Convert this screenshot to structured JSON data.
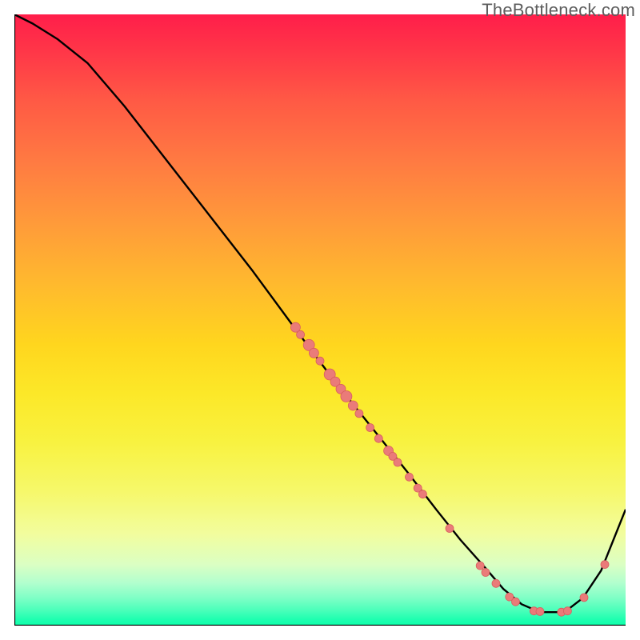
{
  "watermark": "TheBottleneck.com",
  "chart_data": {
    "type": "line",
    "title": "",
    "xlabel": "",
    "ylabel": "",
    "xlim": [
      0,
      100
    ],
    "ylim": [
      0,
      100
    ],
    "grid": false,
    "legend": false,
    "background_gradient": {
      "top": "#ff1e4a",
      "bottom": "#0fffaa"
    },
    "series": [
      {
        "name": "curve",
        "color": "#000000",
        "x": [
          0,
          3,
          7,
          12,
          18,
          25,
          32,
          39,
          46,
          52,
          58,
          64,
          69,
          73,
          77,
          80,
          83,
          86,
          90,
          93,
          96,
          98,
          100
        ],
        "y": [
          100,
          98.5,
          96,
          92,
          85,
          76,
          67,
          58,
          48.5,
          40.5,
          33,
          25.5,
          19,
          14,
          9.5,
          6,
          3.5,
          2.2,
          2.2,
          4.5,
          9,
          14,
          19
        ]
      }
    ],
    "scatter": [
      {
        "name": "red-points",
        "color": "#ea7b79",
        "points": [
          {
            "x": 46.0,
            "y": 48.8,
            "r": 6
          },
          {
            "x": 46.8,
            "y": 47.6,
            "r": 5
          },
          {
            "x": 48.2,
            "y": 45.9,
            "r": 7
          },
          {
            "x": 49.0,
            "y": 44.6,
            "r": 6
          },
          {
            "x": 50.0,
            "y": 43.3,
            "r": 5
          },
          {
            "x": 51.6,
            "y": 41.1,
            "r": 7
          },
          {
            "x": 52.5,
            "y": 39.9,
            "r": 6
          },
          {
            "x": 53.4,
            "y": 38.7,
            "r": 6
          },
          {
            "x": 54.3,
            "y": 37.5,
            "r": 7
          },
          {
            "x": 55.4,
            "y": 36.0,
            "r": 6
          },
          {
            "x": 56.4,
            "y": 34.7,
            "r": 5
          },
          {
            "x": 58.2,
            "y": 32.4,
            "r": 5
          },
          {
            "x": 59.6,
            "y": 30.6,
            "r": 5
          },
          {
            "x": 61.2,
            "y": 28.6,
            "r": 6
          },
          {
            "x": 61.9,
            "y": 27.7,
            "r": 5
          },
          {
            "x": 62.7,
            "y": 26.7,
            "r": 5
          },
          {
            "x": 64.6,
            "y": 24.3,
            "r": 5
          },
          {
            "x": 66.0,
            "y": 22.5,
            "r": 5
          },
          {
            "x": 66.8,
            "y": 21.5,
            "r": 5
          },
          {
            "x": 71.2,
            "y": 15.9,
            "r": 5
          },
          {
            "x": 76.2,
            "y": 9.8,
            "r": 5
          },
          {
            "x": 77.1,
            "y": 8.7,
            "r": 5
          },
          {
            "x": 78.8,
            "y": 6.9,
            "r": 5
          },
          {
            "x": 81.0,
            "y": 4.7,
            "r": 5
          },
          {
            "x": 82.0,
            "y": 3.9,
            "r": 5
          },
          {
            "x": 85.0,
            "y": 2.4,
            "r": 5
          },
          {
            "x": 86.0,
            "y": 2.3,
            "r": 5
          },
          {
            "x": 89.5,
            "y": 2.2,
            "r": 5
          },
          {
            "x": 90.5,
            "y": 2.4,
            "r": 5
          },
          {
            "x": 93.2,
            "y": 4.6,
            "r": 5
          },
          {
            "x": 96.6,
            "y": 10.0,
            "r": 5
          }
        ]
      }
    ]
  }
}
